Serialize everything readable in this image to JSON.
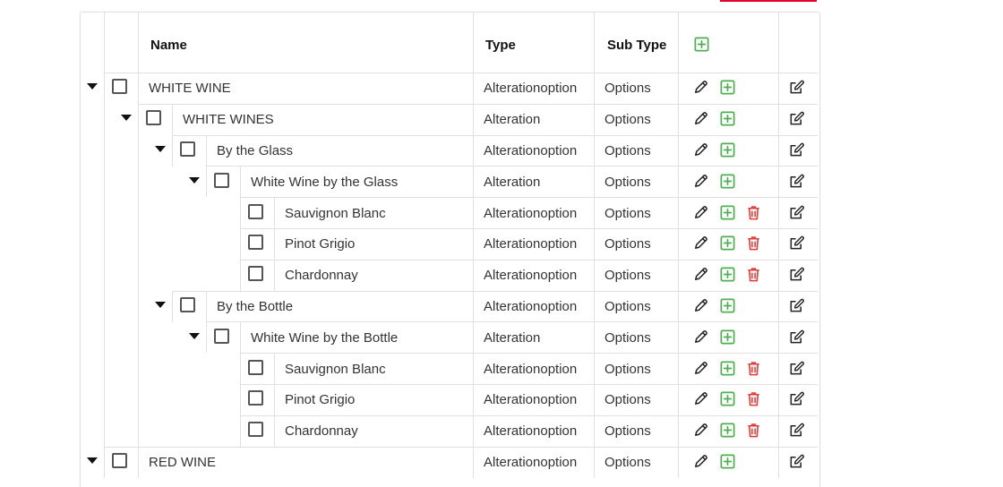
{
  "columns": {
    "name": "Name",
    "type": "Type",
    "subtype": "Sub Type"
  },
  "header_actions": [
    "add-icon"
  ],
  "colors": {
    "add": "#4caf50",
    "delete": "#e53935",
    "icon": "#222222",
    "accent": "#e4002b"
  },
  "rows": [
    {
      "name": "WHITE WINE",
      "type": "Alterationoption",
      "subtype": "Options",
      "level": 0,
      "expandable": true,
      "deletable": false
    },
    {
      "name": "WHITE WINES",
      "type": "Alteration",
      "subtype": "Options",
      "level": 1,
      "expandable": true,
      "deletable": false
    },
    {
      "name": "By the Glass",
      "type": "Alterationoption",
      "subtype": "Options",
      "level": 2,
      "expandable": true,
      "deletable": false
    },
    {
      "name": "White Wine by the Glass",
      "type": "Alteration",
      "subtype": "Options",
      "level": 3,
      "expandable": true,
      "deletable": false
    },
    {
      "name": "Sauvignon Blanc",
      "type": "Alterationoption",
      "subtype": "Options",
      "level": 4,
      "expandable": false,
      "deletable": true
    },
    {
      "name": "Pinot Grigio",
      "type": "Alterationoption",
      "subtype": "Options",
      "level": 4,
      "expandable": false,
      "deletable": true
    },
    {
      "name": "Chardonnay",
      "type": "Alterationoption",
      "subtype": "Options",
      "level": 4,
      "expandable": false,
      "deletable": true
    },
    {
      "name": "By the Bottle",
      "type": "Alterationoption",
      "subtype": "Options",
      "level": 2,
      "expandable": true,
      "deletable": false
    },
    {
      "name": "White Wine by the Bottle",
      "type": "Alteration",
      "subtype": "Options",
      "level": 3,
      "expandable": true,
      "deletable": false
    },
    {
      "name": "Sauvignon Blanc",
      "type": "Alterationoption",
      "subtype": "Options",
      "level": 4,
      "expandable": false,
      "deletable": true
    },
    {
      "name": "Pinot Grigio",
      "type": "Alterationoption",
      "subtype": "Options",
      "level": 4,
      "expandable": false,
      "deletable": true
    },
    {
      "name": "Chardonnay",
      "type": "Alterationoption",
      "subtype": "Options",
      "level": 4,
      "expandable": false,
      "deletable": true
    },
    {
      "name": "RED WINE",
      "type": "Alterationoption",
      "subtype": "Options",
      "level": 0,
      "expandable": true,
      "deletable": false
    }
  ]
}
